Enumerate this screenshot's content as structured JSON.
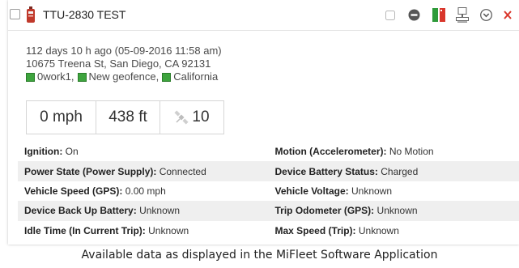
{
  "device": {
    "title": "TTU-2830 TEST"
  },
  "info": {
    "last_report": "112 days 10 h ago (05-09-2016 11:58 am)",
    "address": "10675 Treena St, San Diego, CA 92131",
    "geofences": [
      {
        "label": "0work1,",
        "color": "#3ea43e"
      },
      {
        "label": "New geofence,",
        "color": "#3ea43e"
      },
      {
        "label": "California",
        "color": "#3ea43e"
      }
    ]
  },
  "stats": {
    "speed": "0 mph",
    "altitude": "438 ft",
    "satellites": "10"
  },
  "details": {
    "rows": [
      {
        "shade": false,
        "left_label": "Ignition:",
        "left_value": "On",
        "right_label": "Motion (Accelerometer):",
        "right_value": "No Motion"
      },
      {
        "shade": true,
        "left_label": "Power State (Power Supply):",
        "left_value": "Connected",
        "right_label": "Device Battery Status:",
        "right_value": "Charged"
      },
      {
        "shade": false,
        "left_label": "Vehicle Speed (GPS):",
        "left_value": "0.00 mph",
        "right_label": "Vehicle Voltage:",
        "right_value": "Unknown"
      },
      {
        "shade": true,
        "left_label": "Device Back Up Battery:",
        "left_value": "Unknown",
        "right_label": "Trip Odometer (GPS):",
        "right_value": "Unknown"
      },
      {
        "shade": false,
        "left_label": "Idle Time (In Current Trip):",
        "left_value": "Unknown",
        "right_label": "Max Speed (Trip):",
        "right_value": "Unknown"
      }
    ]
  },
  "caption": "Available data as displayed in the MiFleet Software Application",
  "colors": {
    "geofence_green": "#3ea43e",
    "close_red": "#d9362b",
    "status_icon_green": "#2e9a3a",
    "status_icon_red": "#d9362b",
    "device_icon_red": "#c0392b"
  },
  "icons": [
    "checkbox",
    "device-tracker-icon",
    "square-icon",
    "minus-circle-icon",
    "signal-status-icon",
    "computer-icon",
    "chevron-down-circle-icon",
    "close-icon",
    "satellite-icon"
  ]
}
